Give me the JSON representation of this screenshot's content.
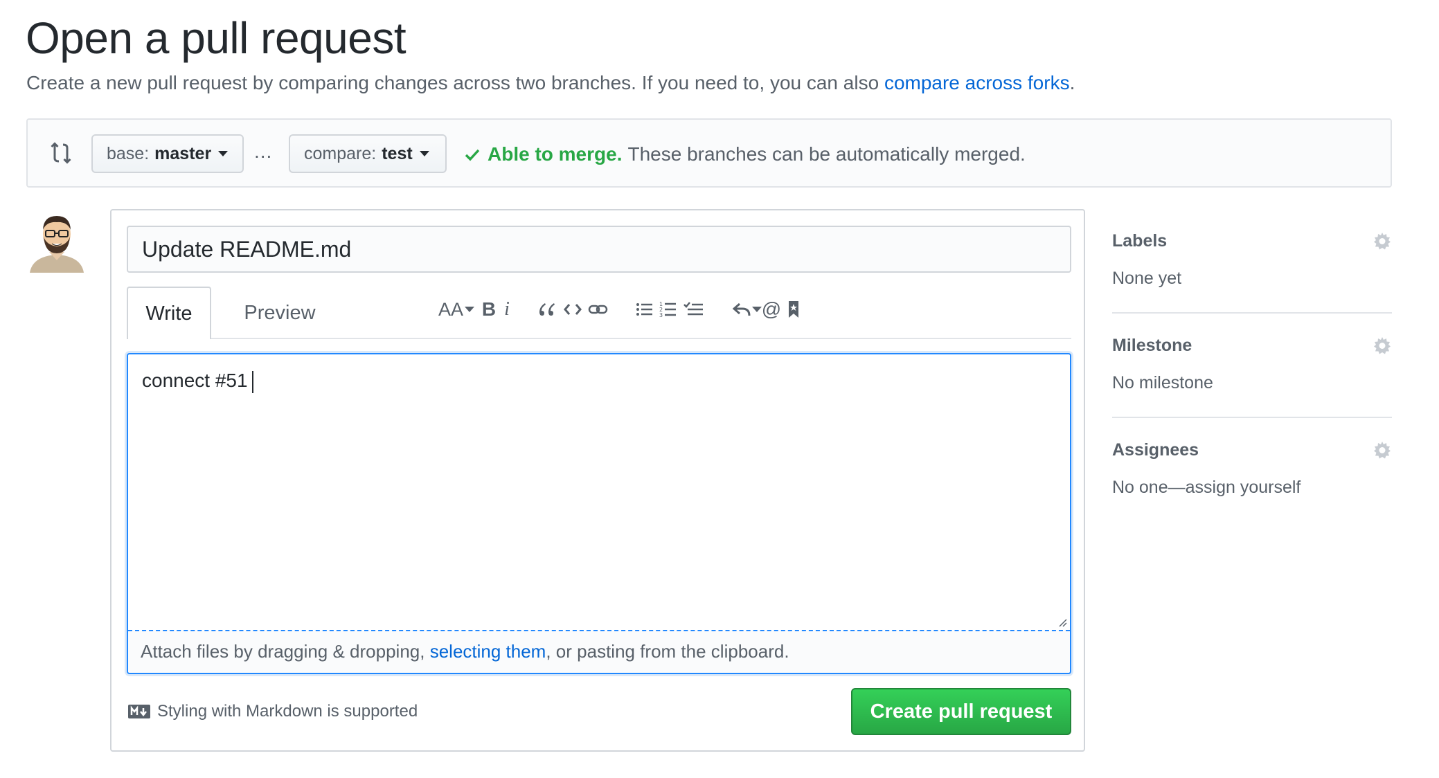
{
  "page": {
    "title": "Open a pull request",
    "subtitle_text": "Create a new pull request by comparing changes across two branches. If you need to, you can also ",
    "subtitle_link": "compare across forks",
    "subtitle_end": "."
  },
  "range": {
    "base_prefix": "base:",
    "base_branch": "master",
    "separator": "...",
    "compare_prefix": "compare:",
    "compare_branch": "test",
    "merge_ok": "Able to merge.",
    "merge_text": "These branches can be automatically merged."
  },
  "form": {
    "title_value": "Update README.md",
    "tabs": [
      {
        "label": "Write",
        "selected": true
      },
      {
        "label": "Preview",
        "selected": false
      }
    ],
    "toolbar_icons": [
      "text-size-icon",
      "bold-icon",
      "italic-icon",
      "quote-icon",
      "code-icon",
      "link-icon",
      "bulleted-list-icon",
      "numbered-list-icon",
      "task-list-icon",
      "reply-icon",
      "mention-icon",
      "bookmark-icon"
    ],
    "toolbar_text": {
      "text_size": "AA",
      "bold": "B",
      "italic": "i",
      "mention": "@"
    },
    "body_value": "connect #51",
    "attach_prefix": "Attach files by dragging & dropping, ",
    "attach_link": "selecting them",
    "attach_suffix": ", or pasting from the clipboard.",
    "markdown_note": "Styling with Markdown is supported",
    "submit_label": "Create pull request"
  },
  "sidebar": {
    "sections": [
      {
        "heading": "Labels",
        "value": "None yet"
      },
      {
        "heading": "Milestone",
        "value": "No milestone"
      },
      {
        "heading": "Assignees",
        "value": "No one—assign yourself"
      }
    ]
  },
  "colors": {
    "link": "#0366d6",
    "success": "#28a745",
    "focus_border": "#2188ff",
    "muted_text": "#586069"
  }
}
